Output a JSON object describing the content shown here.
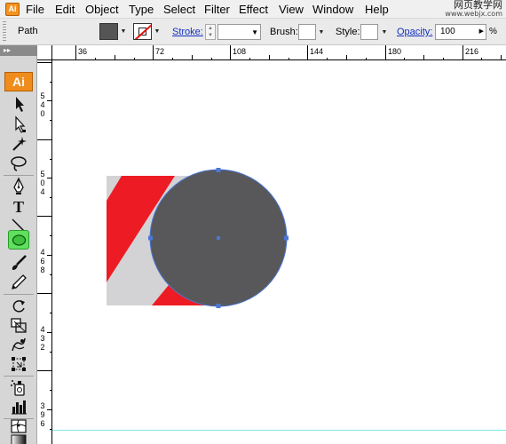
{
  "menubar": {
    "app_icon": "Ai",
    "items": [
      "File",
      "Edit",
      "Object",
      "Type",
      "Select",
      "Filter",
      "Effect",
      "View",
      "Window",
      "Help"
    ]
  },
  "watermark": {
    "line1": "网页教学网",
    "line2": "www.webjx.com"
  },
  "controlbar": {
    "selection_label": "Path",
    "fill_color": "#555555",
    "stroke_color": "none",
    "stroke_label": "Stroke:",
    "stroke_value": "",
    "brush_label": "Brush:",
    "style_label": "Style:",
    "opacity_label": "Opacity:",
    "opacity_value": "100",
    "opacity_unit": "%"
  },
  "toolbox": {
    "collapse_glyph": "▸▸",
    "logo": "Ai",
    "active_tool": "ellipse-tool",
    "tools": [
      {
        "name": "selection-tool",
        "icon": "arrow-icon"
      },
      {
        "name": "direct-selection-tool",
        "icon": "hollow-arrow-icon"
      },
      {
        "name": "magic-wand-tool",
        "icon": "magic-wand-icon"
      },
      {
        "name": "lasso-tool",
        "icon": "lasso-icon"
      },
      {
        "name": "pen-tool",
        "icon": "pen-icon"
      },
      {
        "name": "type-tool",
        "icon": "type-icon",
        "glyph": "T"
      },
      {
        "name": "line-tool",
        "icon": "line-icon"
      },
      {
        "name": "ellipse-tool",
        "icon": "ellipse-icon"
      },
      {
        "name": "paintbrush-tool",
        "icon": "paintbrush-icon"
      },
      {
        "name": "pencil-tool",
        "icon": "pencil-icon"
      },
      {
        "name": "rotate-tool",
        "icon": "rotate-icon"
      },
      {
        "name": "scale-tool",
        "icon": "scale-icon"
      },
      {
        "name": "warp-tool",
        "icon": "warp-icon"
      },
      {
        "name": "free-transform-tool",
        "icon": "free-transform-icon"
      },
      {
        "name": "symbol-sprayer-tool",
        "icon": "symbol-sprayer-icon"
      },
      {
        "name": "column-graph-tool",
        "icon": "graph-icon"
      },
      {
        "name": "mesh-tool",
        "icon": "mesh-icon"
      },
      {
        "name": "gradient-tool",
        "icon": "gradient-icon"
      }
    ]
  },
  "rulers": {
    "horizontal": [
      "36",
      "72",
      "108",
      "144",
      "180",
      "216"
    ],
    "vertical": [
      [
        "5",
        "4",
        "0"
      ],
      [
        "5",
        "0",
        "4"
      ],
      [
        "4",
        "6",
        "8"
      ],
      [
        "4",
        "3",
        "2"
      ],
      [
        "3",
        "9",
        "6"
      ]
    ]
  },
  "artwork": {
    "background_rect_color": "#d3d3d5",
    "stripe_color": "#ed1c24",
    "circle_fill": "#58585a",
    "selection_color": "#4a78d8"
  }
}
